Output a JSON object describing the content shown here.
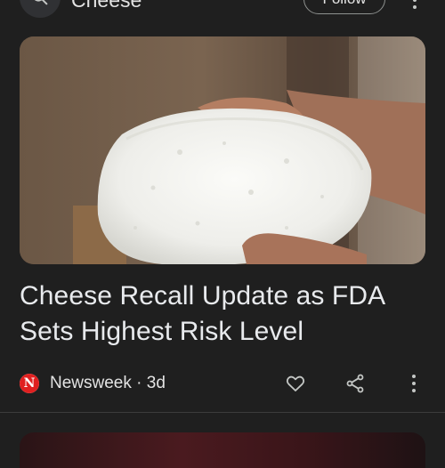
{
  "header": {
    "topic_title": "Cheese",
    "follow_label": "Follow"
  },
  "article": {
    "image_alt": "Hands holding a wheel of white crumbly cheese",
    "headline": "Cheese Recall Update as FDA Sets Highest Risk Level",
    "source_logo_letter": "N",
    "source": "Newsweek",
    "age": "3d"
  },
  "icons": {
    "search": "search-icon",
    "more_top": "more-vert-icon",
    "like": "heart-icon",
    "share": "share-icon",
    "more_article": "more-vert-icon"
  },
  "colors": {
    "background": "#1f1f1f",
    "text": "#e3e3e3",
    "newsweek_red": "#e02020"
  }
}
